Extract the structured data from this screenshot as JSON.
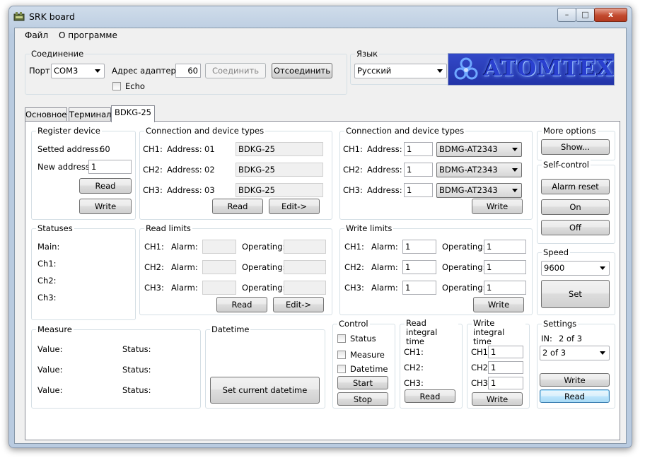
{
  "window": {
    "title": "SRK board",
    "minimize": "–",
    "maximize": "□",
    "close": "x"
  },
  "menu": {
    "file": "Файл",
    "about": "О программе"
  },
  "connection": {
    "title": "Соединение",
    "port_label": "Порт:",
    "port_value": "COM3",
    "adapter_label": "Адрес адаптера:",
    "adapter_value": "60",
    "connect": "Соединить",
    "disconnect": "Отсоединить",
    "echo": "Echo"
  },
  "language": {
    "title": "Язык",
    "value": "Русский"
  },
  "logo": {
    "text": "ATOMTEX"
  },
  "tabs": [
    {
      "label": "Основное"
    },
    {
      "label": "Терминал"
    },
    {
      "label": "BDKG-25"
    }
  ],
  "register": {
    "title": "Register device",
    "setted_label": "Setted address:",
    "setted_value": "60",
    "new_label": "New address:",
    "new_value": "1",
    "read": "Read",
    "write": "Write"
  },
  "conn_read": {
    "title": "Connection and device types",
    "rows": [
      {
        "ch": "CH1:",
        "addr_label": "Address:",
        "addr": "01",
        "type": "BDKG-25"
      },
      {
        "ch": "CH2:",
        "addr_label": "Address:",
        "addr": "02",
        "type": "BDKG-25"
      },
      {
        "ch": "CH3:",
        "addr_label": "Address:",
        "addr": "03",
        "type": "BDKG-25"
      }
    ],
    "read": "Read",
    "edit": "Edit->"
  },
  "conn_write": {
    "title": "Connection and device types",
    "rows": [
      {
        "ch": "CH1:",
        "addr_label": "Address:",
        "addr": "1",
        "type": "BDMG-AT2343"
      },
      {
        "ch": "CH2:",
        "addr_label": "Address:",
        "addr": "1",
        "type": "BDMG-AT2343"
      },
      {
        "ch": "CH3:",
        "addr_label": "Address:",
        "addr": "1",
        "type": "BDMG-AT2343"
      }
    ],
    "write": "Write"
  },
  "more": {
    "title": "More options",
    "show": "Show..."
  },
  "selfcontrol": {
    "title": "Self-control",
    "alarm_reset": "Alarm reset",
    "on": "On",
    "off": "Off"
  },
  "statuses": {
    "title": "Statuses",
    "main": "Main:",
    "ch1": "Ch1:",
    "ch2": "Ch2:",
    "ch3": "Ch3:"
  },
  "read_limits": {
    "title": "Read limits",
    "rows": [
      {
        "ch": "CH1:",
        "alarm_label": "Alarm:",
        "alarm": "",
        "op_label": "Operating:",
        "op": ""
      },
      {
        "ch": "CH2:",
        "alarm_label": "Alarm:",
        "alarm": "",
        "op_label": "Operating:",
        "op": ""
      },
      {
        "ch": "CH3:",
        "alarm_label": "Alarm:",
        "alarm": "",
        "op_label": "Operating:",
        "op": ""
      }
    ],
    "read": "Read",
    "edit": "Edit->"
  },
  "write_limits": {
    "title": "Write limits",
    "rows": [
      {
        "ch": "CH1:",
        "alarm_label": "Alarm:",
        "alarm": "1",
        "op_label": "Operating:",
        "op": "1"
      },
      {
        "ch": "CH2:",
        "alarm_label": "Alarm:",
        "alarm": "1",
        "op_label": "Operating:",
        "op": "1"
      },
      {
        "ch": "CH3:",
        "alarm_label": "Alarm:",
        "alarm": "1",
        "op_label": "Operating:",
        "op": "1"
      }
    ],
    "write": "Write"
  },
  "speed": {
    "title": "Speed",
    "value": "9600",
    "set": "Set"
  },
  "measure": {
    "title": "Measure",
    "rows": [
      {
        "value_label": "Value:",
        "status_label": "Status:"
      },
      {
        "value_label": "Value:",
        "status_label": "Status:"
      },
      {
        "value_label": "Value:",
        "status_label": "Status:"
      }
    ]
  },
  "datetime": {
    "title": "Datetime",
    "set_current": "Set current datetime"
  },
  "control": {
    "title": "Control",
    "status": "Status",
    "measure": "Measure",
    "datetime": "Datetime",
    "start": "Start",
    "stop": "Stop"
  },
  "read_integral": {
    "title": "Read integral time",
    "ch1": "CH1:",
    "ch2": "CH2:",
    "ch3": "CH3:",
    "read": "Read"
  },
  "write_integral": {
    "title": "Write integral time",
    "ch1": "CH1:",
    "ch2": "CH2:",
    "ch3": "CH3:",
    "v1": "1",
    "v2": "1",
    "v3": "1",
    "write": "Write"
  },
  "settings": {
    "title": "Settings",
    "in_label": "IN:",
    "in_value": "2 of 3",
    "combo_value": "2 of 3",
    "write": "Write",
    "read": "Read"
  }
}
